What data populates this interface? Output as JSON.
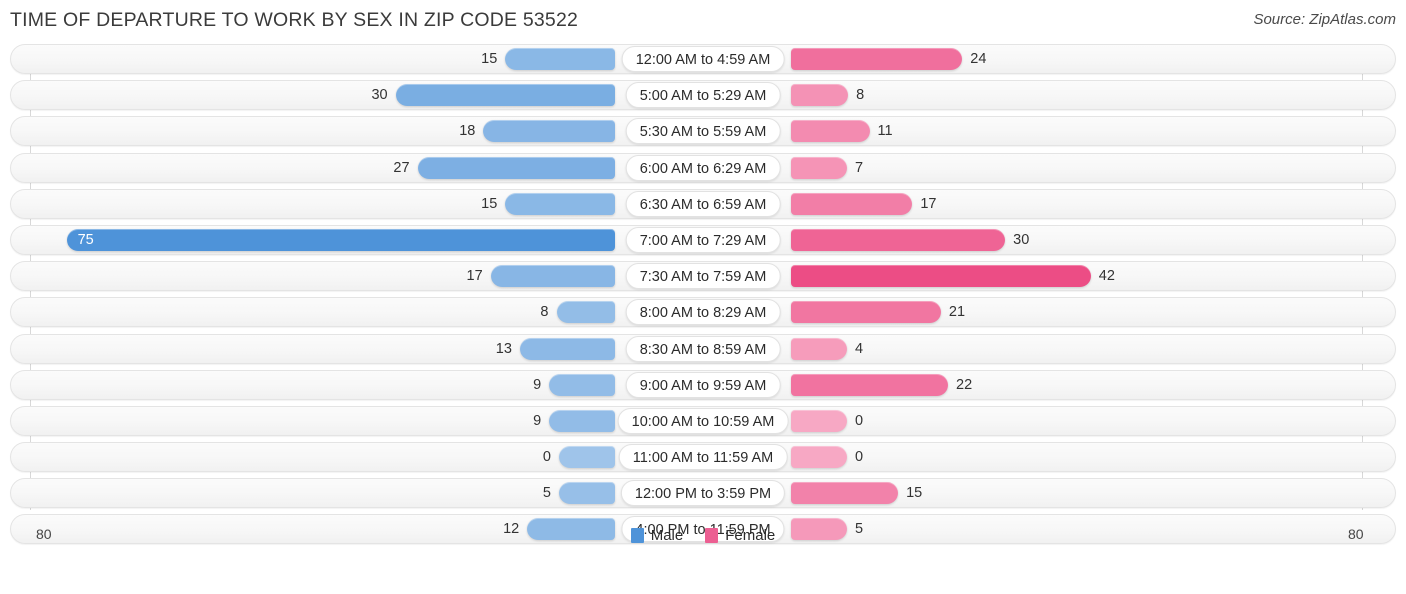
{
  "header": {
    "title": "TIME OF DEPARTURE TO WORK BY SEX IN ZIP CODE 53522",
    "source": "Source: ZipAtlas.com"
  },
  "axis": {
    "left_label": "80",
    "right_label": "80"
  },
  "legend": {
    "items": [
      {
        "label": "Male",
        "color": "#4e93d9"
      },
      {
        "label": "Female",
        "color": "#ec5f92"
      }
    ]
  },
  "colors": {
    "male_max": "#4e93d9",
    "male_low": "#9fc4ea",
    "female_max": "#ec4d85",
    "female_low": "#f7a8c4",
    "track": "#f7f7f7",
    "title": "#3b3b3b"
  },
  "chart_data": {
    "type": "bar",
    "orientation": "horizontal-diverging",
    "title": "TIME OF DEPARTURE TO WORK BY SEX IN ZIP CODE 53522",
    "xlabel": "",
    "ylabel": "",
    "xlim": [
      80,
      80
    ],
    "axis_max": 80,
    "grid": false,
    "legend_position": "bottom-center",
    "categories": [
      "12:00 AM to 4:59 AM",
      "5:00 AM to 5:29 AM",
      "5:30 AM to 5:59 AM",
      "6:00 AM to 6:29 AM",
      "6:30 AM to 6:59 AM",
      "7:00 AM to 7:29 AM",
      "7:30 AM to 7:59 AM",
      "8:00 AM to 8:29 AM",
      "8:30 AM to 8:59 AM",
      "9:00 AM to 9:59 AM",
      "10:00 AM to 10:59 AM",
      "11:00 AM to 11:59 AM",
      "12:00 PM to 3:59 PM",
      "4:00 PM to 11:59 PM"
    ],
    "series": [
      {
        "name": "Male",
        "color": "#4e93d9",
        "side": "left",
        "values": [
          15,
          30,
          18,
          27,
          15,
          75,
          17,
          8,
          13,
          9,
          9,
          0,
          5,
          12
        ]
      },
      {
        "name": "Female",
        "color": "#ec5f92",
        "side": "right",
        "values": [
          24,
          8,
          11,
          7,
          17,
          30,
          42,
          21,
          4,
          22,
          0,
          0,
          15,
          5
        ]
      }
    ]
  }
}
